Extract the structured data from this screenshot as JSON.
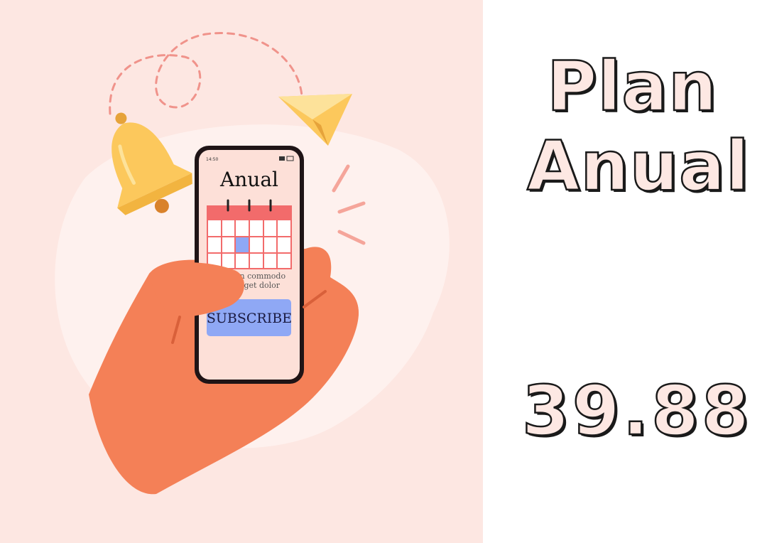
{
  "plan": {
    "title_line1": "Plan",
    "title_line2": "Anual",
    "price": "39.88"
  },
  "phone": {
    "time": "14:50",
    "screen_title": "Anual",
    "body_line1": "an commodo",
    "body_line2": "eget dolor",
    "button_label": "SUBSCRIBE"
  },
  "colors": {
    "background_left": "#fde7e2",
    "hand": "#f48057",
    "bell": "#fcc85c",
    "plane": "#fcc85c",
    "calendar_header": "#f26b6b",
    "calendar_highlight": "#8fa8f5",
    "subscribe_button": "#8fa8f5",
    "title_fill": "#fde8e3",
    "title_stroke": "#1a1a1a"
  },
  "icons": [
    "bell-icon",
    "paper-plane-icon",
    "calendar-icon",
    "signal-icon",
    "battery-icon"
  ]
}
